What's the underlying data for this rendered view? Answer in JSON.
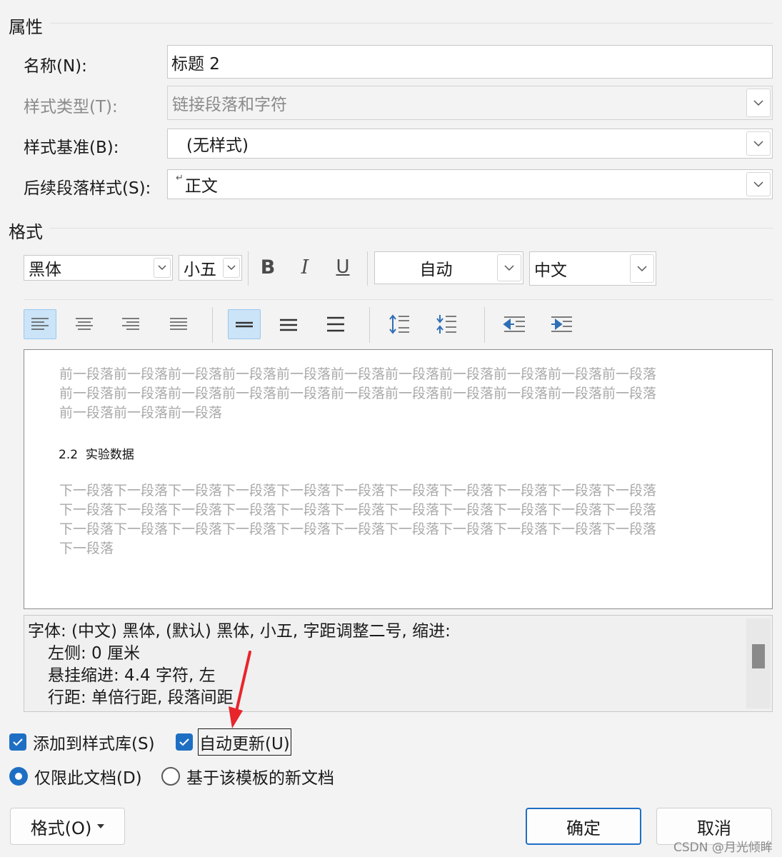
{
  "properties": {
    "section_title": "属性",
    "name_label": "名称(N):",
    "name_value": "标题 2",
    "style_type_label": "样式类型(T):",
    "style_type_value": "链接段落和字符",
    "based_on_label": "样式基准(B):",
    "based_on_value": "(无样式)",
    "next_style_label": "后续段落样式(S):",
    "next_style_mark": "↵",
    "next_style_value": "正文"
  },
  "format": {
    "section_title": "格式",
    "font": "黑体",
    "size": "小五",
    "bold": "B",
    "italic": "I",
    "underline": "U",
    "color": "自动",
    "script": "中文"
  },
  "preview": {
    "prev_lines": [
      "前一段落前一段落前一段落前一段落前一段落前一段落前一段落前一段落前一段落前一段落前一段落",
      "前一段落前一段落前一段落前一段落前一段落前一段落前一段落前一段落前一段落前一段落前一段落",
      "前一段落前一段落前一段落"
    ],
    "sample": "2.2  实验数据",
    "next_lines": [
      "下一段落下一段落下一段落下一段落下一段落下一段落下一段落下一段落下一段落下一段落下一段落",
      "下一段落下一段落下一段落下一段落下一段落下一段落下一段落下一段落下一段落下一段落下一段落",
      "下一段落下一段落下一段落下一段落下一段落下一段落下一段落下一段落下一段落下一段落下一段落",
      "下一段落"
    ]
  },
  "description": {
    "lines": [
      "字体: (中文) 黑体, (默认) 黑体, 小五, 字距调整二号, 缩进:",
      "左侧:  0 厘米",
      "悬挂缩进: 4.4 字符, 左",
      "行距: 单倍行距, 段落间距"
    ]
  },
  "options": {
    "add_to_gallery": "添加到样式库(S)",
    "auto_update": "自动更新(U)",
    "only_this_doc": "仅限此文档(D)",
    "new_docs_template": "基于该模板的新文档"
  },
  "buttons": {
    "format": "格式(O)",
    "ok": "确定",
    "cancel": "取消"
  },
  "watermark": "CSDN @月光倾眸",
  "colors": {
    "accent": "#1e6fc4",
    "arrow": "#e8252b"
  }
}
